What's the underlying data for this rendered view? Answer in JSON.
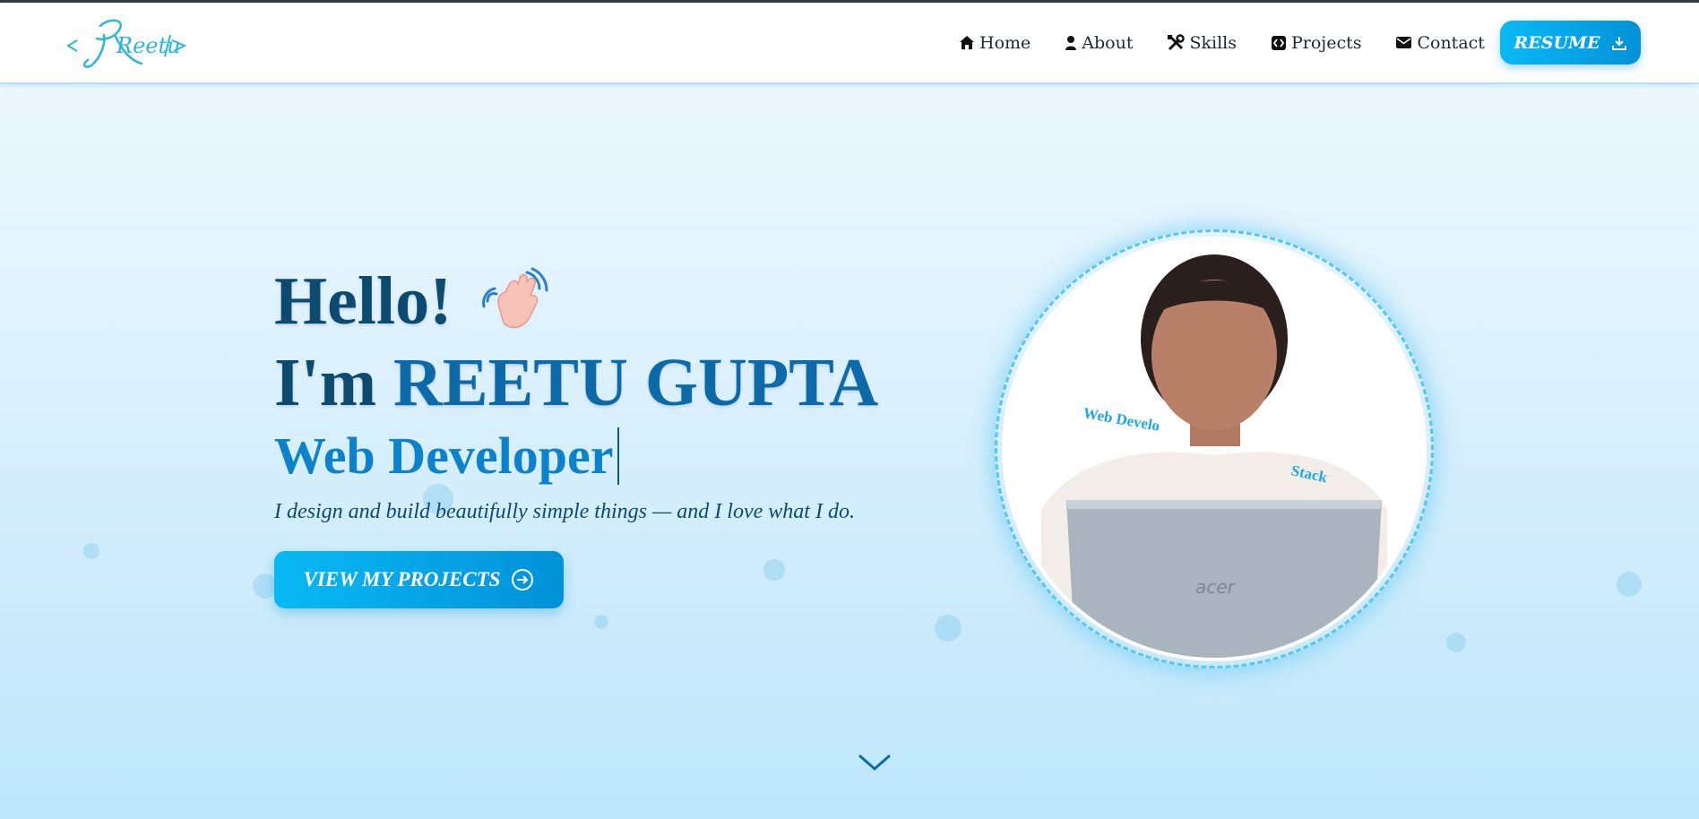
{
  "header": {
    "logo_text": "Reetu",
    "nav": [
      {
        "label": "Home",
        "icon": "home-icon"
      },
      {
        "label": "About",
        "icon": "user-icon"
      },
      {
        "label": "Skills",
        "icon": "tools-icon"
      },
      {
        "label": "Projects",
        "icon": "code-icon"
      },
      {
        "label": "Contact",
        "icon": "envelope-icon"
      }
    ],
    "resume_label": "RESUME"
  },
  "hero": {
    "greeting": "Hello!",
    "intro": "I'm",
    "name": "REETU GUPTA",
    "role": "Web Developer",
    "tagline": "I design and build beautifully simple things — and I love what I do.",
    "cta_label": "VIEW MY PROJECTS"
  },
  "photo": {
    "orbit_text_1": "Web Develo",
    "orbit_text_2": "Stack",
    "laptop_brand": "acer"
  },
  "colors": {
    "accent": "#08b9f4",
    "accent_dark": "#0291d8",
    "heading": "#0d4a70",
    "name": "#0c6aa8",
    "role": "#0c82cc"
  }
}
